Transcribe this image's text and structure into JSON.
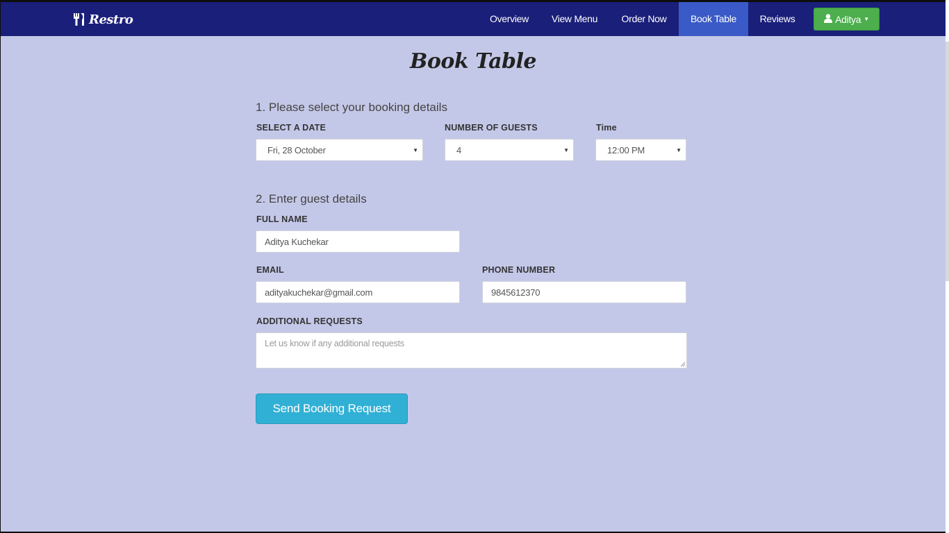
{
  "brand": {
    "name": "Restro",
    "icon": "cutlery-icon"
  },
  "nav": {
    "items": [
      {
        "label": "Overview",
        "active": false
      },
      {
        "label": "View Menu",
        "active": false
      },
      {
        "label": "Order Now",
        "active": false
      },
      {
        "label": "Book Table",
        "active": true
      },
      {
        "label": "Reviews",
        "active": false
      }
    ],
    "user": {
      "label": "Aditya",
      "icon": "user-icon"
    }
  },
  "page": {
    "title": "Book Table"
  },
  "booking": {
    "heading": "1. Please select your booking details",
    "date": {
      "label": "SELECT A DATE",
      "value": "Fri, 28 October"
    },
    "guests": {
      "label": "NUMBER OF GUESTS",
      "value": "4"
    },
    "time": {
      "label": "Time",
      "value": "12:00 PM"
    }
  },
  "guest": {
    "heading": "2. Enter guest details",
    "full_name": {
      "label": "FULL NAME",
      "value": "Aditya Kuchekar"
    },
    "email": {
      "label": "EMAIL",
      "value": "adityakuchekar@gmail.com"
    },
    "phone": {
      "label": "PHONE NUMBER",
      "value": "9845612370"
    },
    "requests": {
      "label": "ADDITIONAL REQUESTS",
      "placeholder": "Let us know if any additional requests"
    }
  },
  "submit": {
    "label": "Send Booking Request"
  },
  "colors": {
    "navbar": "#1a1f7a",
    "active_nav": "#3a5bc7",
    "page_bg": "#c4c8e8",
    "user_button": "#4cae4c",
    "submit_button": "#31b0d5"
  }
}
